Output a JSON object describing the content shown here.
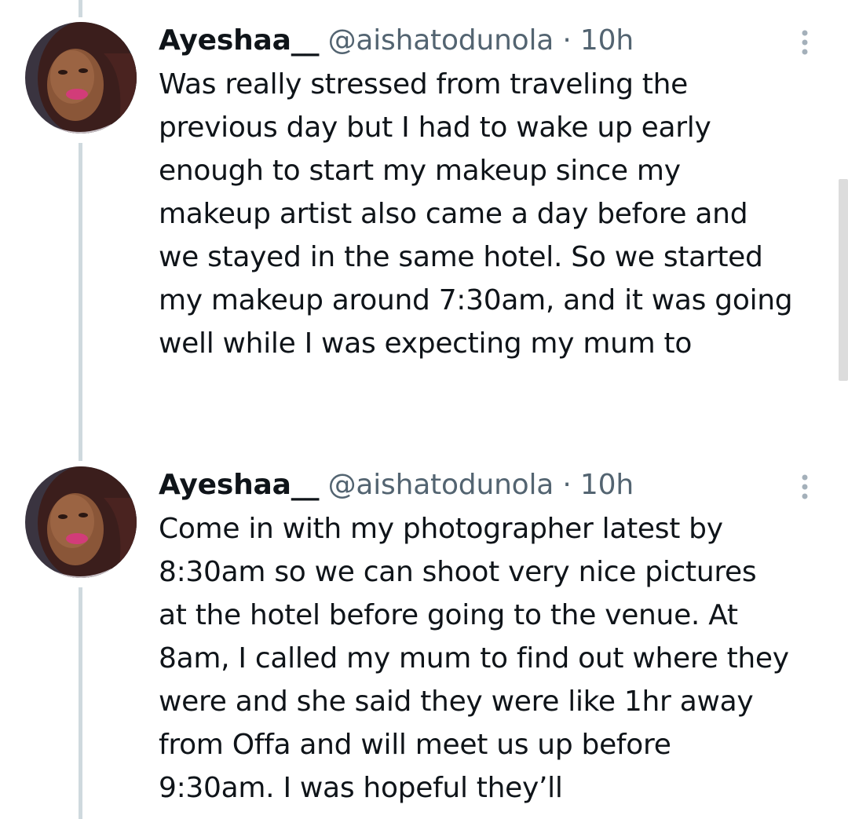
{
  "thread": {
    "tweets": [
      {
        "display_name": "Ayeshaa__",
        "handle": "@aishatodunola",
        "separator": "·",
        "timestamp": "10h",
        "avatar_icon": "profile-photo",
        "more_icon": "more-vertical-icon",
        "text_lines": [
          "Was really stressed from traveling the",
          "previous day but I had to wake up early",
          "enough to start my makeup since my",
          "makeup artist also came a day before and",
          "we stayed in the same hotel. So we started",
          "my makeup around 7:30am, and it was going",
          "well while I was expecting my mum to"
        ]
      },
      {
        "display_name": "Ayeshaa__",
        "handle": "@aishatodunola",
        "separator": "·",
        "timestamp": "10h",
        "avatar_icon": "profile-photo",
        "more_icon": "more-vertical-icon",
        "text_lines": [
          "Come in with my photographer latest by",
          "8:30am so we can shoot very nice pictures",
          "at the hotel before going to the venue. At",
          "8am, I called my mum to find out where they",
          "were and she said they were like 1hr away",
          "from Offa and will meet us up before",
          "9:30am. I was hopeful they’ll"
        ]
      }
    ]
  },
  "colors": {
    "text_primary": "#0f1419",
    "text_secondary": "#536471",
    "thread_line": "#cfd9de",
    "background": "#ffffff"
  }
}
